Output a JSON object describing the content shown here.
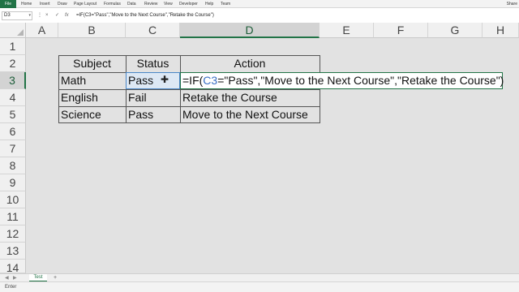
{
  "ribbon": {
    "file_label": "File",
    "menus": [
      "Home",
      "Insert",
      "Draw",
      "Page Layout",
      "Formulas",
      "Data",
      "Review",
      "View",
      "Developer",
      "Help",
      "Team"
    ],
    "share_label": "Share"
  },
  "formula_bar": {
    "name_box": "D3",
    "formula": "=IF(C3=\"Pass\",\"Move to the Next Course\",\"Retake the Course\")",
    "cancel_icon": "×",
    "enter_icon": "✓",
    "fx_label": "fx"
  },
  "columns": [
    "A",
    "B",
    "C",
    "D",
    "E",
    "F",
    "G",
    "H"
  ],
  "rows": [
    "1",
    "2",
    "3",
    "4",
    "5",
    "6",
    "7",
    "8",
    "9",
    "10",
    "11",
    "12",
    "13",
    "14"
  ],
  "table": {
    "headers": [
      "Subject",
      "Status",
      "Action"
    ],
    "rows": [
      {
        "subject": "Math",
        "status": "Pass",
        "action": ""
      },
      {
        "subject": "English",
        "status": "Fail",
        "action": "Retake the Course"
      },
      {
        "subject": "Science",
        "status": "Pass",
        "action": "Move to the Next Course"
      }
    ]
  },
  "edit": {
    "prefix": "=IF(",
    "ref": "C3",
    "suffix": "=\"Pass\",\"Move to the Next Course\",\"Retake the Course\")"
  },
  "sheet_tabs": {
    "active": "Test",
    "add_icon": "+"
  },
  "status_bar": {
    "mode": "Enter"
  },
  "colors": {
    "accent": "#217346",
    "selection": "#dde8f4",
    "ref": "#3a6fc4"
  }
}
